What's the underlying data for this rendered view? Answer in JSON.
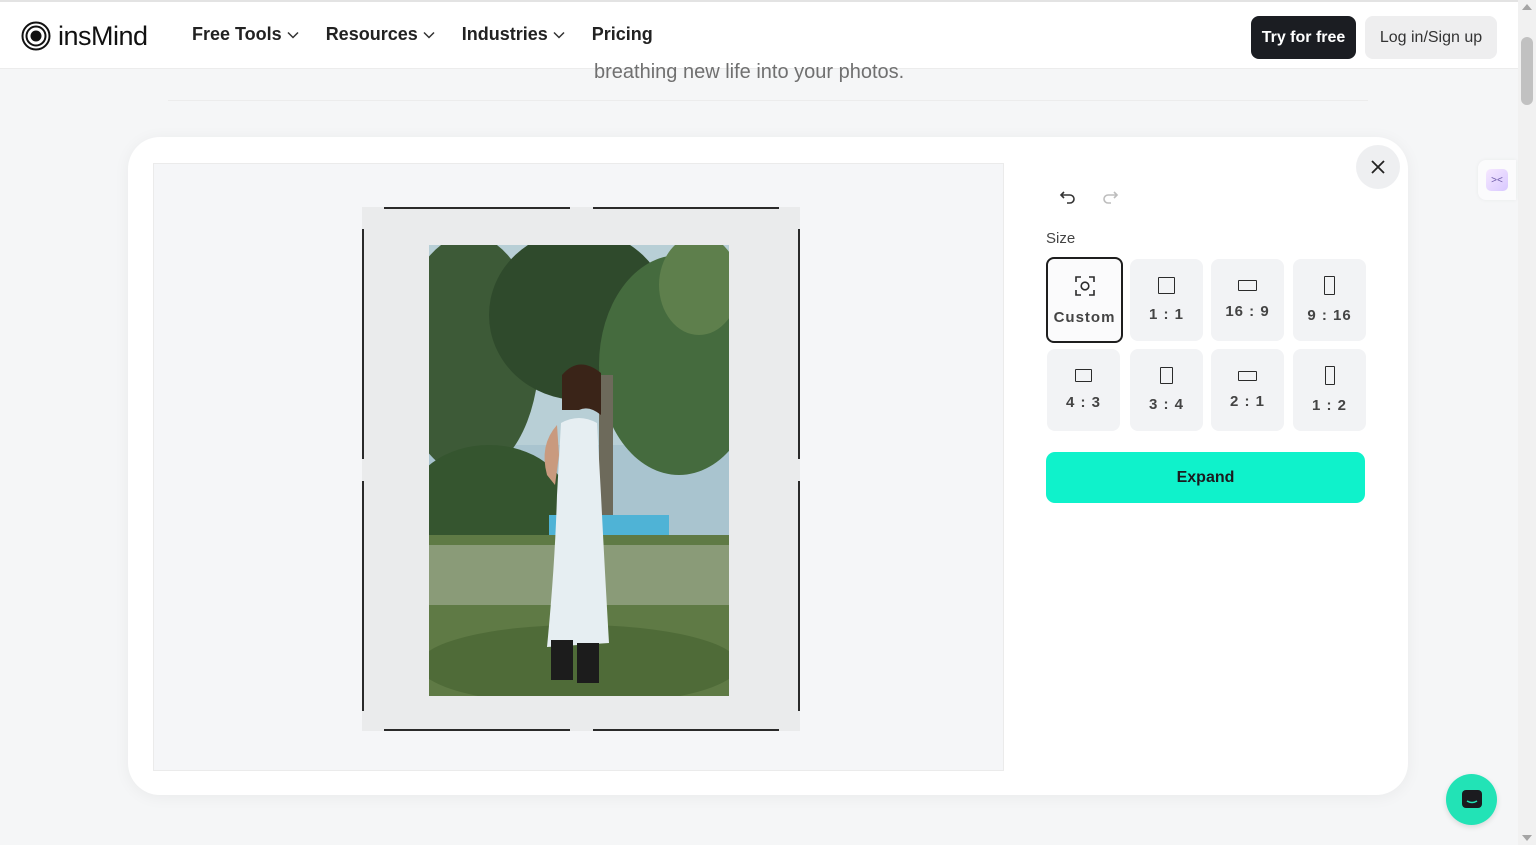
{
  "nav": {
    "brand": "insMind",
    "menu": [
      {
        "label": "Free Tools",
        "has_dropdown": true
      },
      {
        "label": "Resources",
        "has_dropdown": true
      },
      {
        "label": "Industries",
        "has_dropdown": true
      },
      {
        "label": "Pricing",
        "has_dropdown": false
      }
    ],
    "try_label": "Try for free",
    "login_label": "Log in/Sign up"
  },
  "background": {
    "subtitle_fragment": "breathing new life into your photos."
  },
  "editor": {
    "size_label": "Size",
    "size_options": [
      {
        "label": "Custom",
        "icon": "custom-focus-icon",
        "selected": true
      },
      {
        "label": "1 : 1",
        "icon": "square-ratio-icon",
        "selected": false
      },
      {
        "label": "16 : 9",
        "icon": "wide-ratio-icon",
        "selected": false
      },
      {
        "label": "9 : 16",
        "icon": "tall-ratio-icon",
        "selected": false
      },
      {
        "label": "4 : 3",
        "icon": "landscape-ratio-icon",
        "selected": false
      },
      {
        "label": "3 : 4",
        "icon": "portrait-ratio-icon",
        "selected": false
      },
      {
        "label": "2 : 1",
        "icon": "wide-ratio-icon",
        "selected": false
      },
      {
        "label": "1 : 2",
        "icon": "tall-ratio-icon",
        "selected": false
      }
    ],
    "expand_label": "Expand"
  },
  "colors": {
    "accent": "#0ff2cb",
    "chat": "#22e3b6",
    "dark_button": "#1b1d22"
  }
}
